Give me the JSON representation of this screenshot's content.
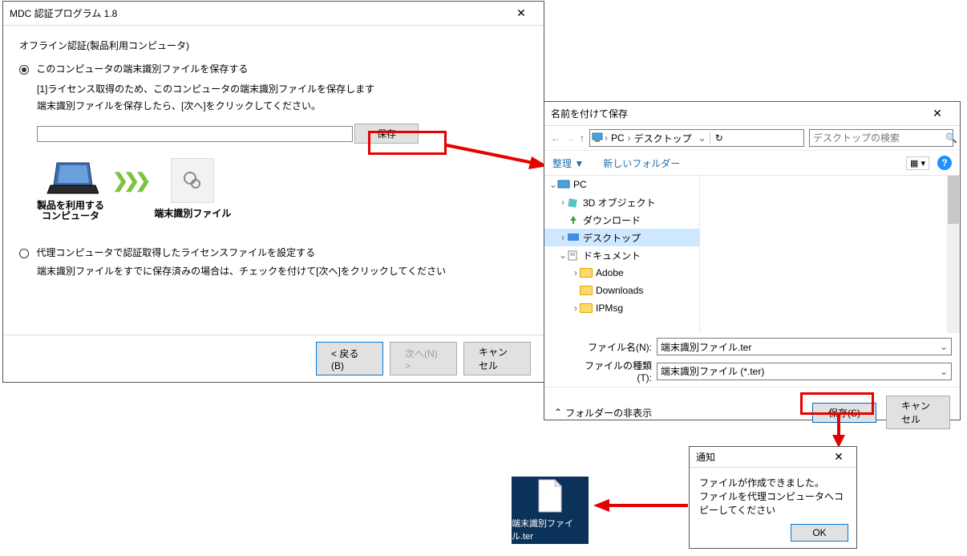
{
  "mdc": {
    "title": "MDC 認証プログラム 1.8",
    "heading": "オフライン認証(製品利用コンピュータ)",
    "opt1": "このコンピュータの端末識別ファイルを保存する",
    "line1": "[1]ライセンス取得のため、このコンピュータの端末識別ファイルを保存します",
    "line2": "端末識別ファイルを保存したら、[次へ]をクリックしてください。",
    "save_btn": "保存",
    "product_label1": "製品を利用する",
    "product_label2": "コンピュータ",
    "terminal_label": "端末識別ファイル",
    "opt2": "代理コンピュータで認証取得したライセンスファイルを設定する",
    "line3": "端末識別ファイルをすでに保存済みの場合は、チェックを付けて[次へ]をクリックしてください",
    "back_btn": "< 戻る(B)",
    "next_btn": "次へ(N) >",
    "cancel_btn": "キャンセル"
  },
  "saveas": {
    "title": "名前を付けて保存",
    "path_pc": "PC",
    "path_desktop": "デスクトップ",
    "search_placeholder": "デスクトップの検索",
    "organize": "整理 ▼",
    "new_folder": "新しいフォルダー",
    "tree_pc": "PC",
    "tree_3d": "3D オブジェクト",
    "tree_dl": "ダウンロード",
    "tree_desktop": "デスクトップ",
    "tree_docs": "ドキュメント",
    "tree_adobe": "Adobe",
    "tree_downloads": "Downloads",
    "tree_ipmsg": "IPMsg",
    "filename_label": "ファイル名(N):",
    "filename_value": "端末識別ファイル.ter",
    "filetype_label": "ファイルの種類(T):",
    "filetype_value": "端末識別ファイル (*.ter)",
    "hide_folders": "フォルダーの非表示",
    "save_btn": "保存(S)",
    "cancel_btn": "キャンセル"
  },
  "fileicon": {
    "label": "端末識別ファイル.ter"
  },
  "notify": {
    "title": "通知",
    "msg1": "ファイルが作成できました。",
    "msg2": "ファイルを代理コンピュータへコピーしてください",
    "ok": "OK"
  }
}
